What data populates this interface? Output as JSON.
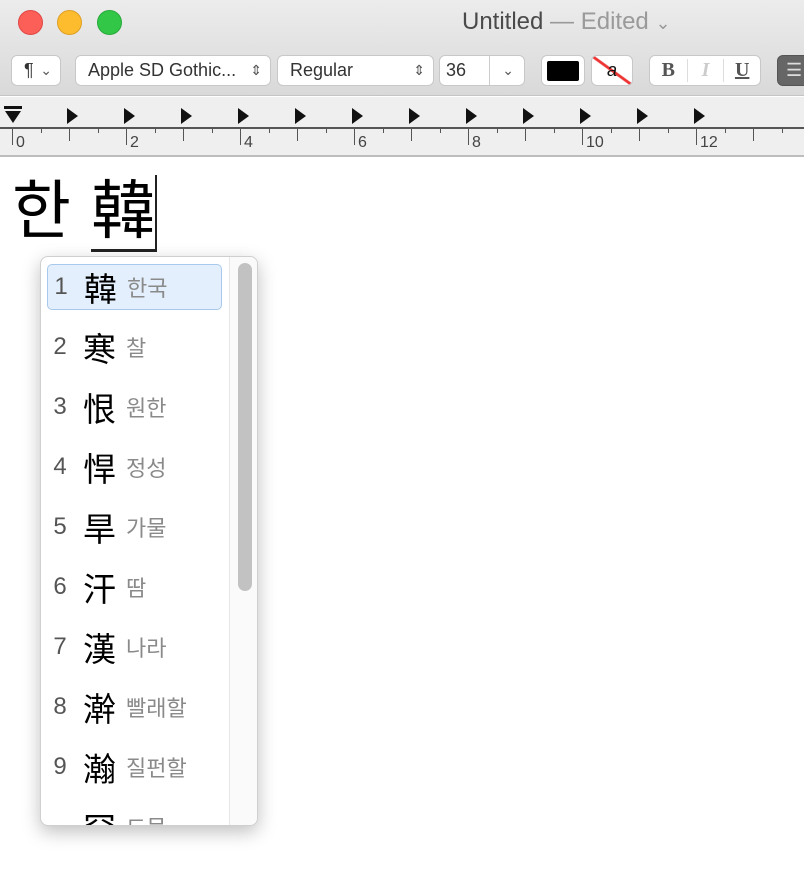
{
  "window": {
    "title": "Untitled",
    "status": "— Edited",
    "chevron": "⌄"
  },
  "toolbar": {
    "paragraph": "¶",
    "font_family": "Apple SD Gothic...",
    "font_style": "Regular",
    "font_size": "36",
    "bold": "B",
    "italic": "I",
    "underline": "U",
    "text_color": "#000000",
    "highlight_label": "a"
  },
  "ruler": {
    "labels": [
      "0",
      "2",
      "4",
      "6",
      "8",
      "10",
      "12"
    ]
  },
  "document": {
    "text": "한 ",
    "composing": "韓"
  },
  "candidates": [
    {
      "n": "1",
      "hanja": "韓",
      "reading": "한국"
    },
    {
      "n": "2",
      "hanja": "寒",
      "reading": "찰"
    },
    {
      "n": "3",
      "hanja": "恨",
      "reading": "원한"
    },
    {
      "n": "4",
      "hanja": "悍",
      "reading": "정성"
    },
    {
      "n": "5",
      "hanja": "旱",
      "reading": "가물"
    },
    {
      "n": "6",
      "hanja": "汗",
      "reading": "땀"
    },
    {
      "n": "7",
      "hanja": "漢",
      "reading": "나라"
    },
    {
      "n": "8",
      "hanja": "澣",
      "reading": "빨래할"
    },
    {
      "n": "9",
      "hanja": "瀚",
      "reading": "질펀할"
    },
    {
      "n": "",
      "hanja": "罕",
      "reading": "드물"
    }
  ]
}
